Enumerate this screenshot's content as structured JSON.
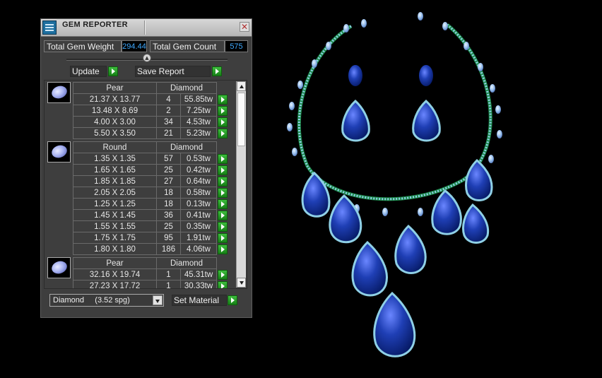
{
  "window": {
    "title": "GEM REPORTER",
    "close_glyph": "✕"
  },
  "stats": {
    "weight_label": "Total Gem Weight",
    "weight_value": "294.44",
    "count_label": "Total Gem Count",
    "count_value": "575"
  },
  "toolbar": {
    "update_label": "Update",
    "save_label": "Save Report"
  },
  "groups": [
    {
      "shape": "Pear",
      "material": "Diamond",
      "icon": "pear-gem-icon",
      "rows": [
        {
          "size": "21.37 X 13.77",
          "count": "4",
          "weight": "55.85tw"
        },
        {
          "size": "13.48 X 8.69",
          "count": "2",
          "weight": "7.25tw"
        },
        {
          "size": "4.00 X 3.00",
          "count": "34",
          "weight": "4.53tw"
        },
        {
          "size": "5.50 X 3.50",
          "count": "21",
          "weight": "5.23tw"
        }
      ]
    },
    {
      "shape": "Round",
      "material": "Diamond",
      "icon": "round-gem-icon",
      "rows": [
        {
          "size": "1.35 X 1.35",
          "count": "57",
          "weight": "0.53tw"
        },
        {
          "size": "1.65 X 1.65",
          "count": "25",
          "weight": "0.42tw"
        },
        {
          "size": "1.85 X 1.85",
          "count": "27",
          "weight": "0.64tw"
        },
        {
          "size": "2.05 X 2.05",
          "count": "18",
          "weight": "0.58tw"
        },
        {
          "size": "1.25 X 1.25",
          "count": "18",
          "weight": "0.13tw"
        },
        {
          "size": "1.45 X 1.45",
          "count": "36",
          "weight": "0.41tw"
        },
        {
          "size": "1.55 X 1.55",
          "count": "25",
          "weight": "0.35tw"
        },
        {
          "size": "1.75 X 1.75",
          "count": "95",
          "weight": "1.91tw"
        },
        {
          "size": "1.80 X 1.80",
          "count": "186",
          "weight": "4.06tw"
        }
      ]
    },
    {
      "shape": "Pear",
      "material": "Diamond",
      "icon": "pear-gem-icon",
      "rows": [
        {
          "size": "32.16 X 19.74",
          "count": "1",
          "weight": "45.31tw"
        },
        {
          "size": "27.23 X 17.72",
          "count": "1",
          "weight": "30.33tw"
        }
      ]
    }
  ],
  "material_select": {
    "value": "Diamond     (3.52 spg)"
  },
  "set_material_label": "Set Material",
  "colors": {
    "sapphire": "#1d3fae",
    "diamond": "#8fd0e6",
    "metal": "#1e8a4c",
    "accent_green": "#2a9f2a",
    "value_blue": "#3fa9ff"
  }
}
